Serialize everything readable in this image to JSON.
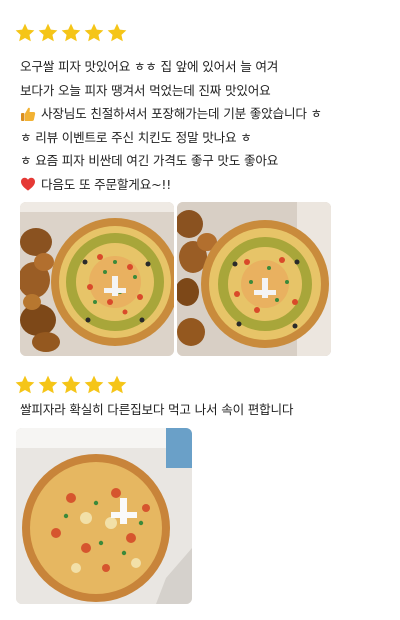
{
  "reviews": [
    {
      "rating": 5,
      "lines": [
        "오구쌀 피자 맛있어요 ㅎㅎ 집 앞에 있어서 늘 여겨",
        "보다가 오늘 피자 땡겨서 먹었는데 진짜 맛있어요",
        "사장님도 친절하셔서 포장해가는데 기분 좋았습니다 ㅎ",
        "ㅎ 리뷰 이벤트로 주신 치킨도 정말 맛나요 ㅎ",
        "ㅎ 요즘 피자 비싼데 여긴 가격도 좋구 맛도 좋아요",
        "다음도 또 주문할게요~!!"
      ],
      "emojis": {
        "thumbs_up": "thumbs-up-icon",
        "heart": "red-heart-icon"
      },
      "photos": [
        {
          "name": "review-photo-pizza-chicken-left",
          "alt": "pizza-with-fried-chicken"
        },
        {
          "name": "review-photo-pizza-chicken-right",
          "alt": "pizza-with-fried-chicken"
        }
      ]
    },
    {
      "rating": 5,
      "lines": [
        "쌀피자라 확실히 다른집보다 먹고 나서 속이 편합니다"
      ],
      "photos": [
        {
          "name": "review-photo-pizza-box",
          "alt": "pizza-in-box"
        }
      ]
    }
  ],
  "colors": {
    "star": "#F5C518",
    "text": "#222222",
    "heart": "#E53935",
    "thumb": "#F2B233"
  }
}
